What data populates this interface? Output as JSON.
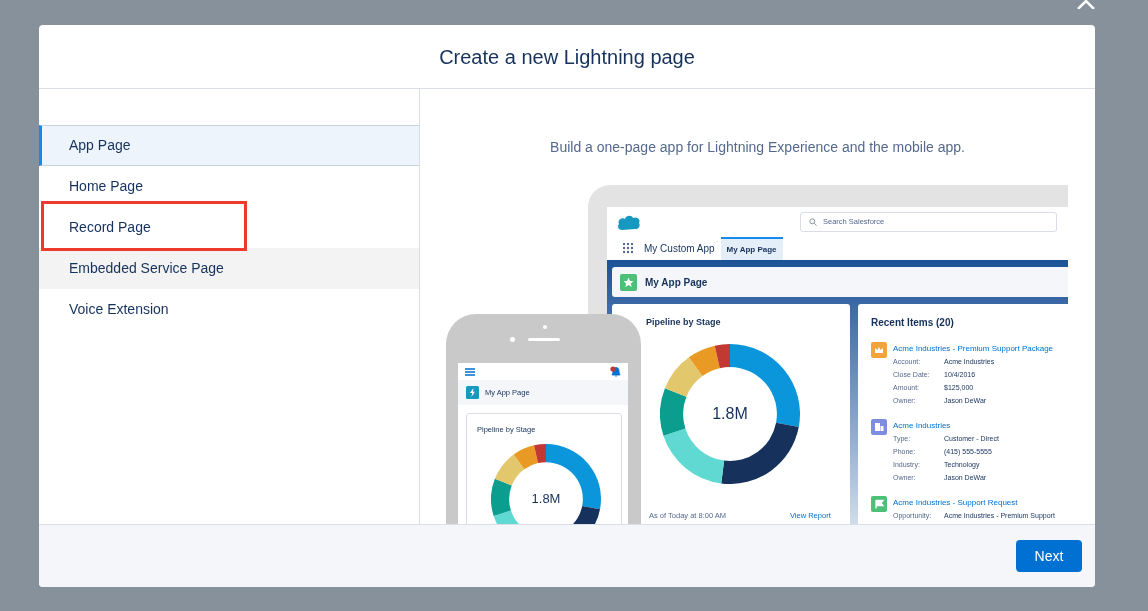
{
  "modal": {
    "title": "Create a new Lightning page"
  },
  "page_types": [
    {
      "label": "App Page",
      "selected": true,
      "hovered": false,
      "highlighted": false
    },
    {
      "label": "Home Page",
      "selected": false,
      "hovered": false,
      "highlighted": false
    },
    {
      "label": "Record Page",
      "selected": false,
      "hovered": false,
      "highlighted": true
    },
    {
      "label": "Embedded Service Page",
      "selected": false,
      "hovered": true,
      "highlighted": false
    },
    {
      "label": "Voice Extension",
      "selected": false,
      "hovered": false,
      "highlighted": false
    }
  ],
  "description": "Build a one-page app for Lightning Experience and the mobile app.",
  "preview": {
    "desktop": {
      "search_placeholder": "Search Salesforce",
      "app_name": "My Custom App",
      "tabs": [
        {
          "label": "My App Page",
          "selected": true
        }
      ],
      "page_title": "My App Page",
      "chart_card": {
        "title": "Pipeline by Stage",
        "center_value": "1.8M",
        "footnote": "As of Today at 8:00 AM",
        "link": "View Report"
      },
      "recent_items": {
        "title": "Recent Items (20)",
        "items": [
          {
            "kind": "crown",
            "color": "#f4a23a",
            "title": "Acme Industries - Premium Support Package",
            "fields": [
              {
                "label": "Account:",
                "value": "Acme Industries"
              },
              {
                "label": "Close Date:",
                "value": "10/4/2016"
              },
              {
                "label": "Amount:",
                "value": "$125,000"
              },
              {
                "label": "Owner:",
                "value": "Jason DeWar"
              }
            ]
          },
          {
            "kind": "building",
            "color": "#7f8de1",
            "title": "Acme Industries",
            "fields": [
              {
                "label": "Type:",
                "value": "Customer - Direct"
              },
              {
                "label": "Phone:",
                "value": "(415) 555-5555"
              },
              {
                "label": "Industry:",
                "value": "Technology"
              },
              {
                "label": "Owner:",
                "value": "Jason DeWar"
              }
            ]
          },
          {
            "kind": "flag",
            "color": "#4bc076",
            "title": "Acme Industries - Support Request",
            "fields": [
              {
                "label": "Opportunity:",
                "value": "Acme Industries - Premium Support"
              }
            ]
          }
        ]
      }
    },
    "mobile": {
      "page_title": "My App Page",
      "chart_card": {
        "title": "Pipeline by Stage",
        "center_value": "1.8M"
      }
    }
  },
  "footer": {
    "next_button": "Next"
  }
}
